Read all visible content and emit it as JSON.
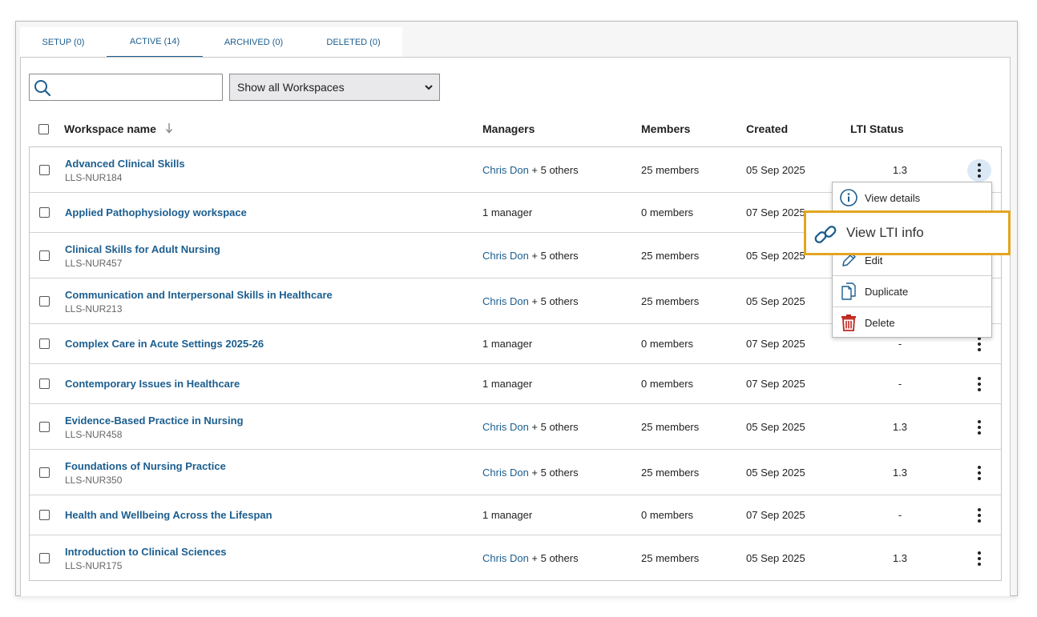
{
  "tabs": [
    {
      "label": "SETUP (0)"
    },
    {
      "label": "ACTIVE (14)"
    },
    {
      "label": "ARCHIVED (0)"
    },
    {
      "label": "DELETED (0)"
    }
  ],
  "search": {
    "value": "",
    "placeholder": ""
  },
  "filter": {
    "selected": "Show all Workspaces"
  },
  "columns": {
    "name": "Workspace name",
    "managers": "Managers",
    "members": "Members",
    "created": "Created",
    "lti": "LTI Status"
  },
  "rows": [
    {
      "name": "Advanced Clinical Skills",
      "code": "LLS-NUR184",
      "manager_link": "Chris Don",
      "manager_rest": " + 5 others",
      "members": "25 members",
      "created": "05 Sep 2025",
      "lti": "1.3"
    },
    {
      "name": "Applied Pathophysiology workspace",
      "code": "",
      "manager_link": "",
      "manager_rest": "1 manager",
      "members": "0 members",
      "created": "07 Sep 2025",
      "lti": ""
    },
    {
      "name": "Clinical Skills for Adult Nursing",
      "code": "LLS-NUR457",
      "manager_link": "Chris Don",
      "manager_rest": " + 5 others",
      "members": "25 members",
      "created": "05 Sep 2025",
      "lti": ""
    },
    {
      "name": "Communication and Interpersonal Skills in Healthcare",
      "code": "LLS-NUR213",
      "manager_link": "Chris Don",
      "manager_rest": " + 5 others",
      "members": "25 members",
      "created": "05 Sep 2025",
      "lti": ""
    },
    {
      "name": "Complex Care in Acute Settings 2025-26",
      "code": "",
      "manager_link": "",
      "manager_rest": "1 manager",
      "members": "0 members",
      "created": "07 Sep 2025",
      "lti": "-"
    },
    {
      "name": "Contemporary Issues in Healthcare",
      "code": "",
      "manager_link": "",
      "manager_rest": "1 manager",
      "members": "0 members",
      "created": "07 Sep 2025",
      "lti": "-"
    },
    {
      "name": "Evidence-Based Practice in Nursing",
      "code": "LLS-NUR458",
      "manager_link": "Chris Don",
      "manager_rest": " + 5 others",
      "members": "25 members",
      "created": "05 Sep 2025",
      "lti": "1.3"
    },
    {
      "name": "Foundations of Nursing Practice",
      "code": "LLS-NUR350",
      "manager_link": "Chris Don",
      "manager_rest": " + 5 others",
      "members": "25 members",
      "created": "05 Sep 2025",
      "lti": "1.3"
    },
    {
      "name": "Health and Wellbeing Across the Lifespan",
      "code": "",
      "manager_link": "",
      "manager_rest": "1 manager",
      "members": "0 members",
      "created": "07 Sep 2025",
      "lti": "-"
    },
    {
      "name": "Introduction to Clinical Sciences",
      "code": "LLS-NUR175",
      "manager_link": "Chris Don",
      "manager_rest": " + 5 others",
      "members": "25 members",
      "created": "05 Sep 2025",
      "lti": "1.3"
    }
  ],
  "menu": {
    "view_details": "View details",
    "view_lti": "View LTI info",
    "edit": "Edit",
    "duplicate": "Duplicate",
    "delete": "Delete"
  },
  "colors": {
    "link": "#1c5e8f",
    "highlight": "#e3a51f",
    "delete_icon": "#c0261f",
    "kebab_active_bg": "#dbe9f6"
  },
  "icons": {
    "search": "search-icon",
    "sort": "arrow-down-icon",
    "dropdown": "chevron-down-icon",
    "row_actions": "kebab-icon",
    "view_details": "info-icon",
    "view_lti": "link-icon",
    "edit": "pencil-icon",
    "duplicate": "copy-icon",
    "delete": "trash-icon"
  }
}
